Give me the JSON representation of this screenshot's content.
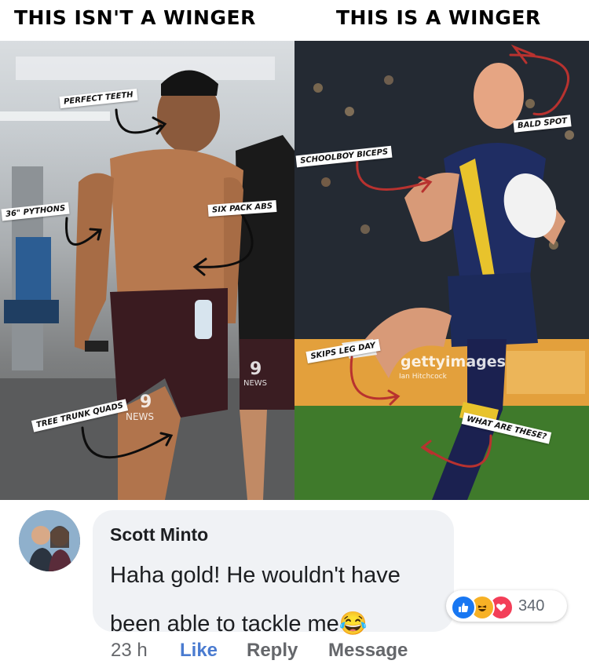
{
  "meme": {
    "left_heading": "THIS ISN'T A WINGER",
    "right_heading": "THIS IS A WINGER",
    "left_labels": {
      "teeth": "PERFECT TEETH",
      "pythons": "36\" PYTHONS",
      "abs": "SIX PACK ABS",
      "quads": "TREE TRUNK QUADS"
    },
    "right_labels": {
      "bald": "BALD SPOT",
      "biceps": "SCHOOLBOY BICEPS",
      "legday": "SKIPS LEG DAY",
      "these": "WHAT ARE THESE?"
    },
    "watermarks": {
      "news_logo": "9",
      "news_text": "NEWS",
      "getty": "gettyimages",
      "getty_credit": "Ian Hitchcock"
    }
  },
  "comment": {
    "author": "Scott Minto",
    "text": "Haha gold! He wouldn't have been able to tackle me😂",
    "reactions": {
      "count": "340",
      "types": [
        "like-icon",
        "haha-icon",
        "love-icon"
      ]
    },
    "meta": {
      "time": "23 h",
      "like": "Like",
      "reply": "Reply",
      "message": "Message"
    }
  },
  "colors": {
    "like_blue": "#1877f2",
    "haha_yellow": "#f7b125",
    "love_red": "#f33e58",
    "bubble_bg": "#f0f2f5",
    "arrow_red": "#c0392b"
  }
}
